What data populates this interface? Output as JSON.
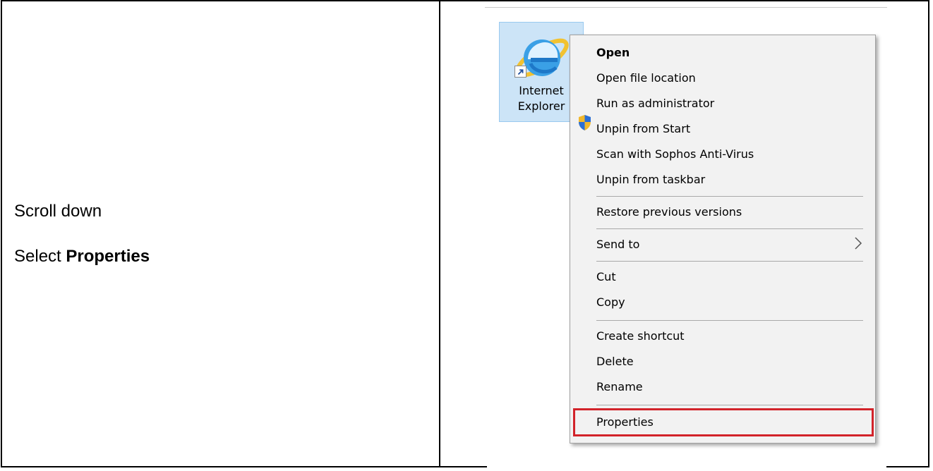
{
  "instructions": {
    "line1": "Scroll down",
    "line2_prefix": "Select ",
    "line2_bold": "Properties"
  },
  "desktop_icon": {
    "label_line1": "Internet",
    "label_line2": "Explorer",
    "icon": "internet-explorer-icon"
  },
  "context_menu": {
    "items": [
      {
        "label": "Open"
      },
      {
        "label": "Open file location"
      },
      {
        "label": "Run as administrator"
      },
      {
        "label": "Unpin from Start"
      },
      {
        "label": "Scan with Sophos Anti-Virus"
      },
      {
        "label": "Unpin from taskbar"
      },
      {
        "label": "Restore previous versions"
      },
      {
        "label": "Send to"
      },
      {
        "label": "Cut"
      },
      {
        "label": "Copy"
      },
      {
        "label": "Create shortcut"
      },
      {
        "label": "Delete"
      },
      {
        "label": "Rename"
      },
      {
        "label": "Properties"
      }
    ]
  },
  "colors": {
    "highlight_border": "#d2232a",
    "selection_tile": "#cce4f7",
    "menu_background": "#f2f2f2"
  }
}
